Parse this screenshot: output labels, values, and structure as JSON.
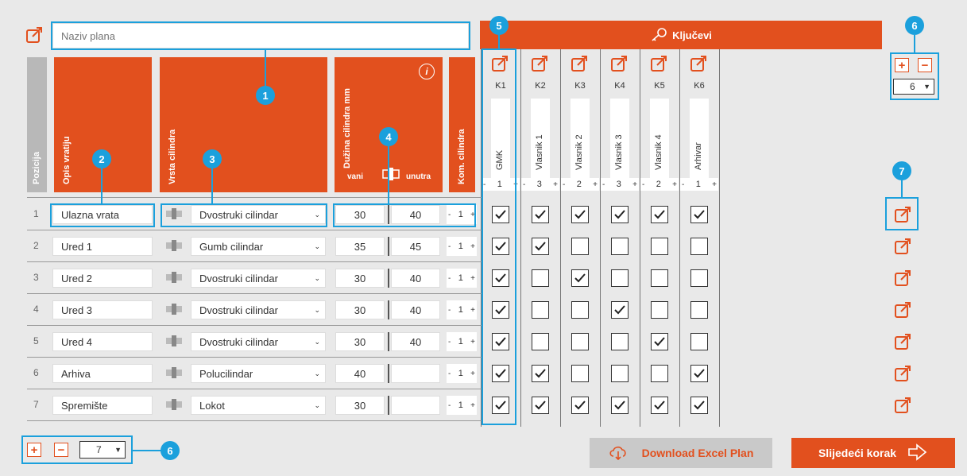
{
  "plan": {
    "placeholder": "Naziv plana"
  },
  "headers": {
    "pozicija": "Pozicija",
    "opis": "Opis vratiju",
    "vrsta": "Vrsta cilindra",
    "duzina": "Dužina cilindra mm",
    "vani": "vani",
    "unutra": "unutra",
    "kom": "Kom. cilindra",
    "kljucevi": "Ključevi"
  },
  "keys": [
    {
      "id": "K1",
      "name": "GMK",
      "count": "1"
    },
    {
      "id": "K2",
      "name": "Vlasnik 1",
      "count": "3"
    },
    {
      "id": "K3",
      "name": "Vlasnik 2",
      "count": "2"
    },
    {
      "id": "K4",
      "name": "Vlasnik 3",
      "count": "3"
    },
    {
      "id": "K5",
      "name": "Vlasnik 4",
      "count": "2"
    },
    {
      "id": "K6",
      "name": "Arhivar",
      "count": "1"
    }
  ],
  "rows": [
    {
      "pos": "1",
      "opis": "Ulazna vrata",
      "vrsta": "Dvostruki cilindar",
      "vani": "30",
      "unutra": "40",
      "kom": "1",
      "checks": [
        true,
        true,
        true,
        true,
        true,
        true
      ]
    },
    {
      "pos": "2",
      "opis": "Ured 1",
      "vrsta": "Gumb cilindar",
      "vani": "35",
      "unutra": "45",
      "kom": "1",
      "checks": [
        true,
        true,
        false,
        false,
        false,
        false
      ]
    },
    {
      "pos": "3",
      "opis": "Ured 2",
      "vrsta": "Dvostruki cilindar",
      "vani": "30",
      "unutra": "40",
      "kom": "1",
      "checks": [
        true,
        false,
        true,
        false,
        false,
        false
      ]
    },
    {
      "pos": "4",
      "opis": "Ured 3",
      "vrsta": "Dvostruki cilindar",
      "vani": "30",
      "unutra": "40",
      "kom": "1",
      "checks": [
        true,
        false,
        false,
        true,
        false,
        false
      ]
    },
    {
      "pos": "5",
      "opis": "Ured 4",
      "vrsta": "Dvostruki cilindar",
      "vani": "30",
      "unutra": "40",
      "kom": "1",
      "checks": [
        true,
        false,
        false,
        false,
        true,
        false
      ]
    },
    {
      "pos": "6",
      "opis": "Arhiva",
      "vrsta": "Polucilindar",
      "vani": "40",
      "unutra": "",
      "kom": "1",
      "checks": [
        true,
        true,
        false,
        false,
        false,
        true
      ]
    },
    {
      "pos": "7",
      "opis": "Spremište",
      "vrsta": "Lokot",
      "vani": "30",
      "unutra": "",
      "kom": "1",
      "checks": [
        true,
        true,
        true,
        true,
        true,
        true
      ]
    }
  ],
  "controls": {
    "keys_count": "6",
    "rows_count": "7",
    "plus": "+",
    "minus": "−",
    "minus_small": "-",
    "plus_small": "+"
  },
  "buttons": {
    "download": "Download Excel Plan",
    "next": "Slijedeći korak"
  },
  "callouts": [
    "1",
    "2",
    "3",
    "4",
    "5",
    "6",
    "7",
    "6"
  ],
  "colors": {
    "accent": "#e2501e",
    "callout": "#1ba0dc",
    "disabled": "#c9c9c9"
  }
}
